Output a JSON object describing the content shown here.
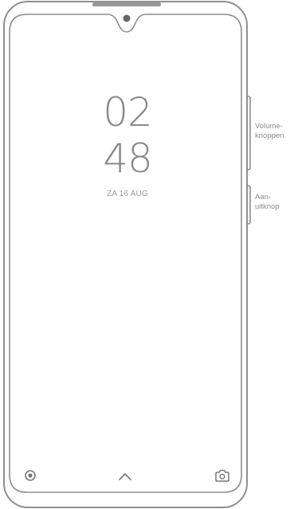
{
  "lock_screen": {
    "clock_hours": "02",
    "clock_minutes": "48",
    "date": "ZA 16 AUG"
  },
  "callouts": {
    "volume_buttons": "Volume-\nknoppen",
    "power_button": "Aan-\nuitknop"
  },
  "icons": {
    "bottom_left": "circle-dot-icon",
    "bottom_center": "chevron-up-icon",
    "bottom_right": "camera-icon"
  },
  "colors": {
    "outline": "#8f8f8f",
    "text": "#8a8a8a",
    "background": "#ffffff"
  }
}
